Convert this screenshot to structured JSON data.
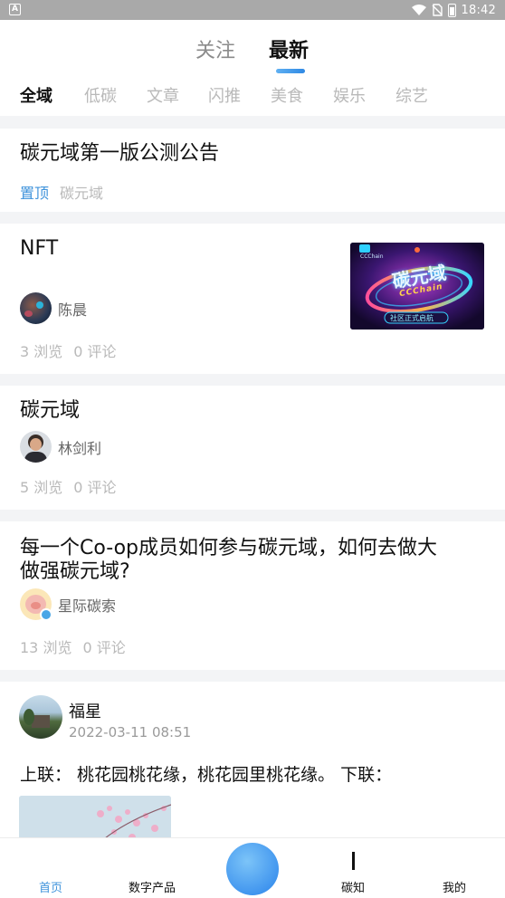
{
  "status_bar": {
    "app_badge": "A",
    "time": "18:42",
    "icons": [
      "wifi-icon",
      "no-sim-icon",
      "battery-icon"
    ]
  },
  "header": {
    "main_tabs": [
      {
        "label": "关注",
        "active": false
      },
      {
        "label": "最新",
        "active": true
      }
    ],
    "categories": [
      "全域",
      "低碳",
      "文章",
      "闪推",
      "美食",
      "娱乐",
      "综艺"
    ],
    "active_category": "全域"
  },
  "feed": {
    "announcement": {
      "title": "碳元域第一版公测公告",
      "tag": "置顶",
      "source": "碳元域"
    },
    "post_nft": {
      "title": "NFT",
      "author": "陈晨",
      "views": "3 浏览",
      "comments": "0 评论",
      "thumbnail": {
        "caption_top": "CCChain",
        "logo": "碳元域",
        "subtitle": "CCChain",
        "badge": "社区正式启航"
      }
    },
    "post_domain": {
      "title": "碳元域",
      "author": "林剑利",
      "views": "5 浏览",
      "comments": "0 评论"
    },
    "post_coop": {
      "title_line1": "每一个Co-op成员如何参与碳元域，如何去做大",
      "title_line2": "做强碳元域?",
      "author": "星际碳索",
      "views": "13 浏览",
      "comments": "0 评论"
    },
    "post_fuxing": {
      "author": "福星",
      "timestamp": "2022-03-11 08:51",
      "text": "上联： 桃花园桃花缘，桃花园里桃花缘。 下联："
    }
  },
  "bottom_nav": {
    "items": [
      {
        "label": "首页",
        "active": true
      },
      {
        "label": "数字产品",
        "active": false
      },
      {
        "label": "碳知",
        "active": false
      },
      {
        "label": "我的",
        "active": false
      }
    ]
  },
  "colors": {
    "accent": "#3f93db",
    "muted": "#b9b9b9",
    "background": "#f3f4f6"
  }
}
